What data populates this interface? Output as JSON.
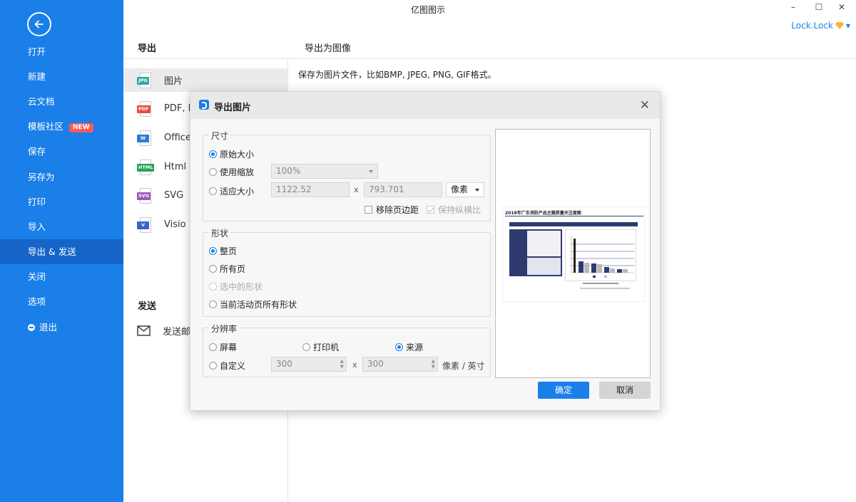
{
  "window": {
    "title": "亿图图示",
    "user": "Lock.Lock"
  },
  "sidebar": {
    "items": [
      {
        "label": "打开"
      },
      {
        "label": "新建"
      },
      {
        "label": "云文档"
      },
      {
        "label": "模板社区",
        "badge": "NEW"
      },
      {
        "label": "保存"
      },
      {
        "label": "另存为"
      },
      {
        "label": "打印"
      },
      {
        "label": "导入"
      },
      {
        "label": "导出 & 发送",
        "active": true
      },
      {
        "label": "关闭"
      },
      {
        "label": "选项"
      },
      {
        "label": "退出"
      }
    ]
  },
  "export_panel": {
    "title": "导出",
    "items": [
      {
        "tag": "JPG",
        "label": "图片",
        "color": "#2ea8a0"
      },
      {
        "tag": "PDF",
        "label": "PDF, PS, EPS",
        "color": "#e84c3d"
      },
      {
        "tag": "W",
        "label": "Office",
        "color": "#2b7cd3"
      },
      {
        "tag": "HTML",
        "label": "Html",
        "color": "#27a35a"
      },
      {
        "tag": "SVG",
        "label": "SVG",
        "color": "#9b59b6"
      },
      {
        "tag": "V",
        "label": "Visio",
        "color": "#3a63c8"
      }
    ],
    "send_title": "发送",
    "send_item": "发送邮件"
  },
  "right_panel": {
    "title": "导出为图像",
    "description": "保存为图片文件，比如BMP, JPEG, PNG, GIF格式。"
  },
  "dialog": {
    "title": "导出图片",
    "size_group": {
      "title": "尺寸",
      "original": "原始大小",
      "use_scale": "使用缩放",
      "scale_value": "100%",
      "fit_size": "适应大小",
      "width": "1122.52",
      "height": "793.701",
      "x_sep": "x",
      "unit": "像素",
      "remove_margin": "移除页边距",
      "keep_ratio": "保持纵横比"
    },
    "shape_group": {
      "title": "形状",
      "whole_page": "整页",
      "all_pages": "所有页",
      "selected": "选中的形状",
      "current_page_all": "当前活动页所有形状"
    },
    "resolution_group": {
      "title": "分辨率",
      "screen": "屏幕",
      "printer": "打印机",
      "source": "来源",
      "custom": "自定义",
      "dpi_x": "300",
      "dpi_y": "300",
      "x_sep": "x",
      "unit": "像素 / 英寸"
    },
    "preview_title": "2018年广东消防产品主题质量关注度图",
    "ok": "确定",
    "cancel": "取消"
  },
  "colors": {
    "accent": "#1a7fe8",
    "sidebar_active": "#1565c8",
    "badge": "#ff5a5a"
  }
}
